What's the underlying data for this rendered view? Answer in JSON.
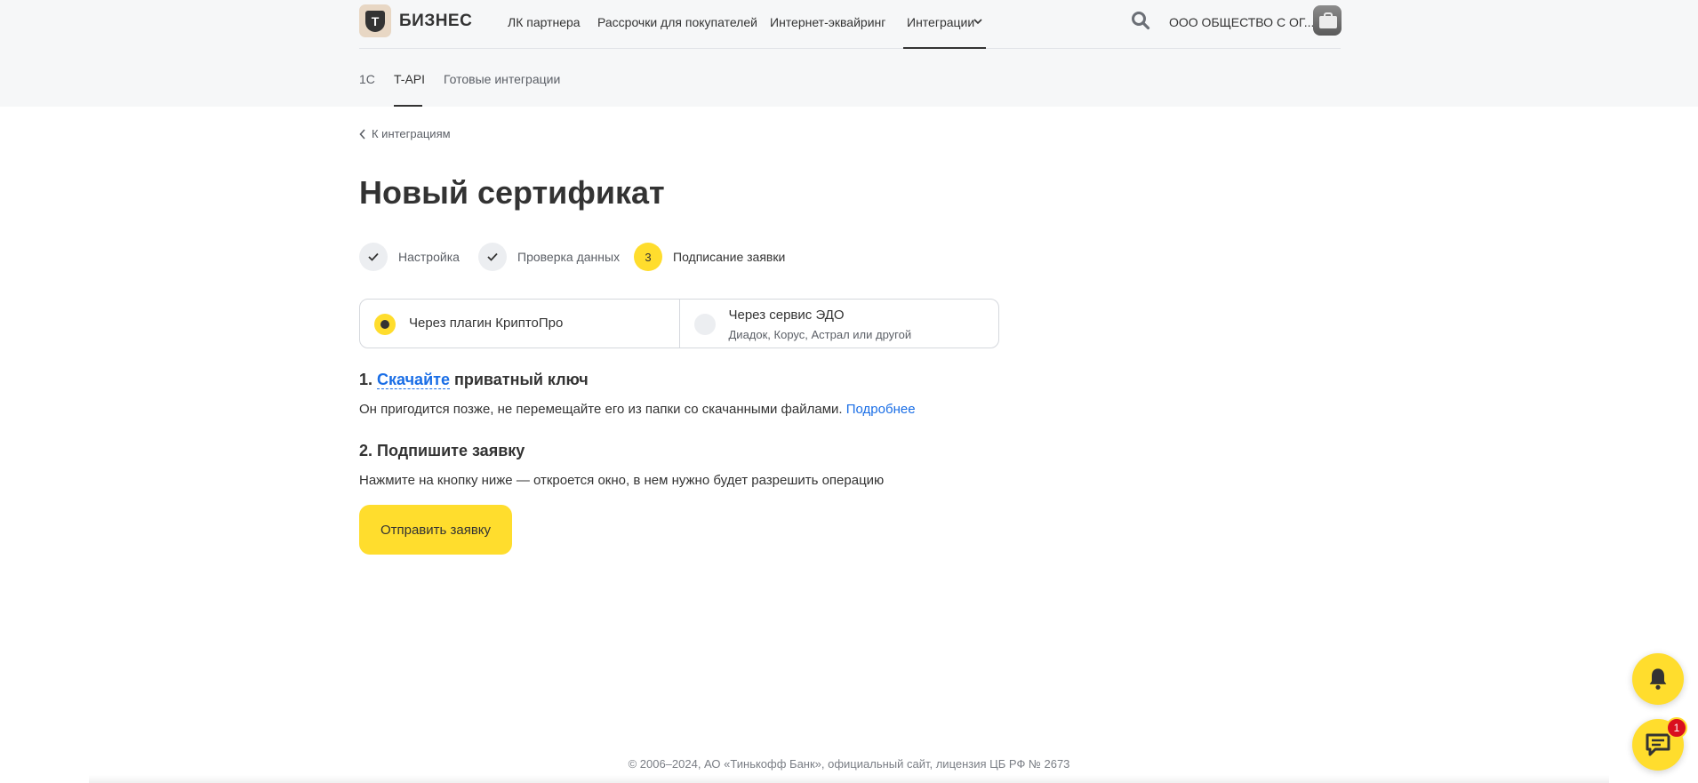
{
  "brand": {
    "name": "БИЗНЕС",
    "logo_letter": "Т"
  },
  "nav": {
    "links": [
      "ЛК партнера",
      "Рассрочки для покупателей",
      "Интернет-эквайринг"
    ],
    "active": "Интеграции",
    "org": "ООО ОБЩЕСТВО С ОГ..."
  },
  "subnav": {
    "links": [
      "1С",
      "T-API",
      "Готовые интеграции"
    ]
  },
  "back": {
    "label": "К интеграциям"
  },
  "page": {
    "title": "Новый сертификат"
  },
  "steps": [
    {
      "label": "Настройка",
      "state": "done"
    },
    {
      "label": "Проверка данных",
      "state": "done"
    },
    {
      "label": "Подписание заявки",
      "state": "current",
      "number": "3"
    }
  ],
  "method": {
    "options": [
      {
        "title": "Через плагин КриптоПро",
        "selected": true
      },
      {
        "title": "Через сервис ЭДО",
        "subtitle": "Диадок, Корус, Астрал или другой",
        "selected": false
      }
    ]
  },
  "step1": {
    "prefix": "1.",
    "link": "Скачайте",
    "suffix": "приватный ключ",
    "text": "Он пригодится позже, не перемещайте его из папки со скачанными файлами.",
    "more": "Подробнее"
  },
  "step2": {
    "title": "2. Подпишите заявку",
    "text": "Нажмите на кнопку ниже — откроется окно, в нем нужно будет разрешить операцию"
  },
  "submit": {
    "label": "Отправить заявку"
  },
  "footer": {
    "text": "© 2006–2024, АО «Тинькофф Банк», официальный сайт, лицензия ЦБ РФ № 2673"
  },
  "chat": {
    "badge": "1"
  },
  "colors": {
    "accent": "#ffdd2d",
    "link": "#1a6ee6",
    "badge": "#d90f1f"
  }
}
